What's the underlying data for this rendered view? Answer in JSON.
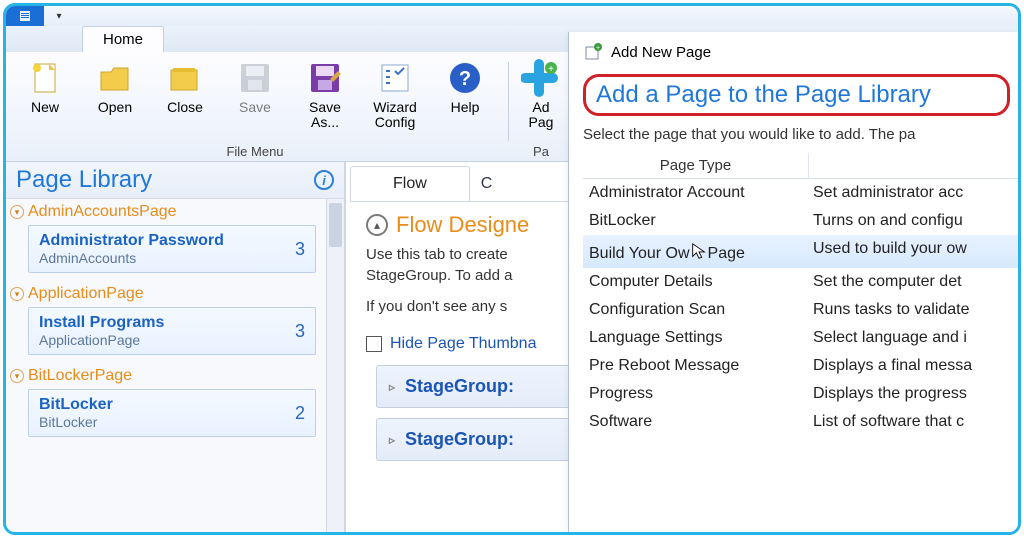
{
  "titlebar": {
    "home_tab": "Home"
  },
  "ribbon": {
    "new": "New",
    "open": "Open",
    "close": "Close",
    "save": "Save",
    "saveas": "Save As...",
    "wizard": "Wizard Config",
    "help": "Help",
    "addpage": "Ad\nPag",
    "group_file": "File Menu",
    "group_page": "Pa"
  },
  "sidebar": {
    "title": "Page Library",
    "cats": [
      {
        "head": "AdminAccountsPage",
        "item": {
          "name": "Administrator Password",
          "sub": "AdminAccounts",
          "count": "3"
        }
      },
      {
        "head": "ApplicationPage",
        "item": {
          "name": "Install Programs",
          "sub": "ApplicationPage",
          "count": "3"
        }
      },
      {
        "head": "BitLockerPage",
        "item": {
          "name": "BitLocker",
          "sub": "BitLocker",
          "count": "2"
        }
      }
    ]
  },
  "content": {
    "tabs": {
      "flow": "Flow",
      "other": "C"
    },
    "flow_title": "Flow Designe",
    "p1": "Use this tab to create",
    "p2": "StageGroup. To add a",
    "p3": "If you don't see any s",
    "hide_label": "Hide Page Thumbna",
    "stage1": "StageGroup:",
    "stage2": "StageGroup: "
  },
  "dialog": {
    "title": "Add New Page",
    "heading": "Add a Page to the Page Library",
    "subtitle": "Select the page that you would like to add. The pa",
    "col1": "Page Type",
    "rows": [
      {
        "t": "Administrator Account",
        "d": "Set administrator acc"
      },
      {
        "t": "BitLocker",
        "d": "Turns on and configu"
      },
      {
        "t": "Build Your Own Page",
        "d": "Used to build your ow"
      },
      {
        "t": "Computer Details",
        "d": "Set the computer det"
      },
      {
        "t": "Configuration Scan",
        "d": "Runs tasks to validate"
      },
      {
        "t": "Language Settings",
        "d": "Select language and i"
      },
      {
        "t": "Pre Reboot Message",
        "d": "Displays a final messa"
      },
      {
        "t": "Progress",
        "d": "Displays the progress"
      },
      {
        "t": "Software",
        "d": "List of software that c"
      }
    ],
    "selected_index": 2
  }
}
